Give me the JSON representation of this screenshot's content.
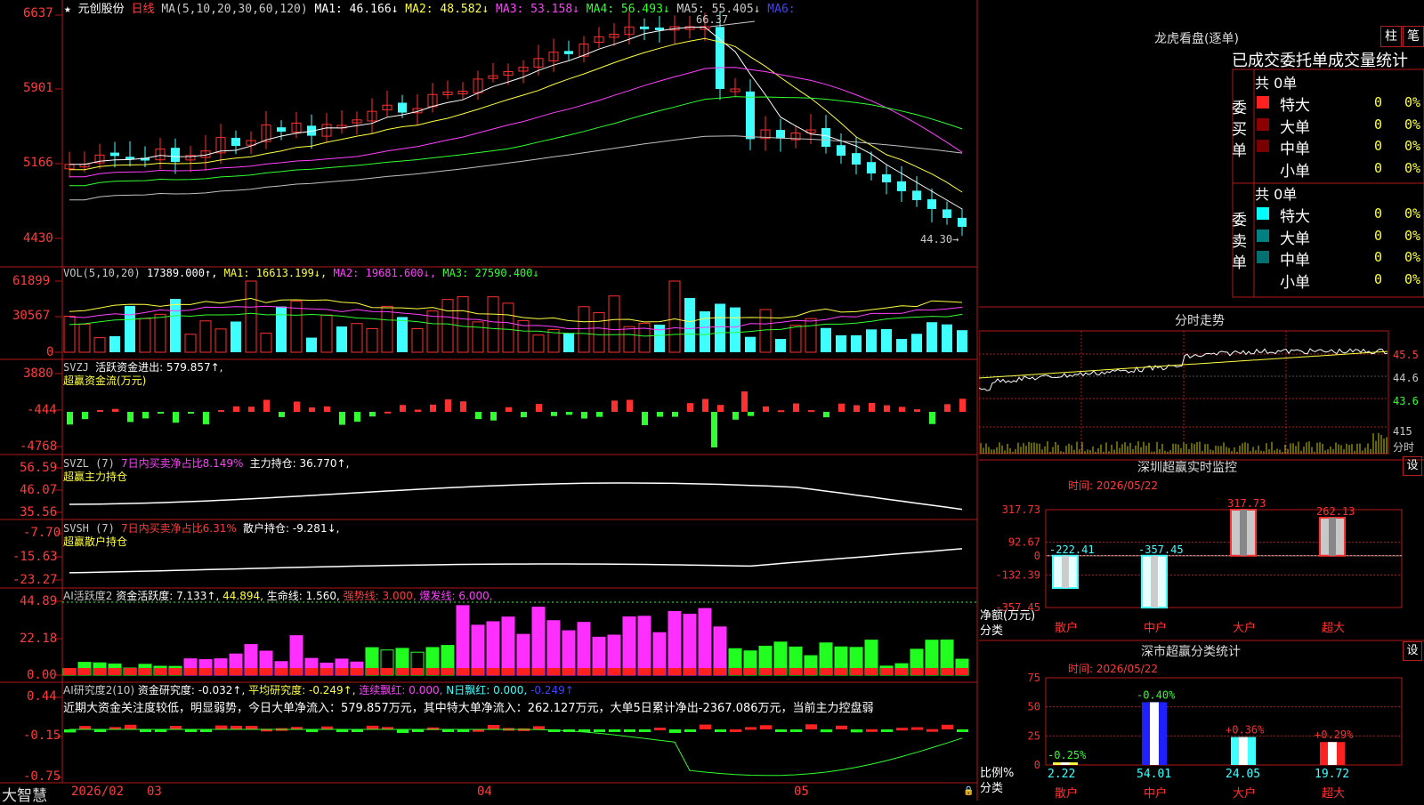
{
  "app": {
    "brand": "大智慧"
  },
  "main": {
    "header": {
      "star": "★",
      "stock_name": "元创股份",
      "period": "日线",
      "ma_params": "MA(5,10,20,30,60,120)",
      "ma1": "MA1: 46.166↓",
      "ma2": "MA2: 48.582↓",
      "ma3": "MA3: 53.158↓",
      "ma4": "MA4: 56.493↓",
      "ma5": "MA5: 55.405↓",
      "ma6": "MA6:"
    },
    "price_axis": [
      "6637",
      "5901",
      "5166",
      "4430"
    ],
    "high_label": "66.37",
    "low_label": "44.30→"
  },
  "vol": {
    "header_name": "VOL(5,10,20)",
    "header_val": "17389.000↑",
    "ma1": "MA1: 16613.199↓",
    "ma2": "MA2: 19681.600↓",
    "ma3": "MA3: 27590.400↓",
    "axis": [
      "61899",
      "30567",
      "0"
    ]
  },
  "svzj": {
    "line1_name": "SVZJ",
    "line1_val": "活跃资金进出: 579.857↑,",
    "line2": "超赢资金流(万元)",
    "axis": [
      "3880",
      "-444",
      "-4768"
    ]
  },
  "svzl": {
    "name": "SVZL (7)",
    "ratio": "7日内买卖净占比8.149%",
    "val": "主力持仓: 36.770↑,",
    "line2": "超赢主力持仓",
    "axis": [
      "56.59",
      "46.07",
      "35.56"
    ]
  },
  "svsh": {
    "name": "SVSH (7)",
    "ratio": "7日内买卖净占比6.31%",
    "val": "散户持仓: -9.281↓,",
    "line2": "超赢散户持仓",
    "axis": [
      "-7.70",
      "-15.63",
      "-23.27"
    ]
  },
  "ai": {
    "name": "AI活跃度2",
    "v1": "资金活跃度: 7.133↑",
    "v2": "44.894,",
    "v3": "生命线: 1.560,",
    "v4": "强势线: 3.000,",
    "v5": "爆发线: 6.000,",
    "axis": [
      "44.89",
      "22.18",
      "0.00"
    ]
  },
  "research": {
    "name": "AI研究度2(10)",
    "v1": "资金研究度: -0.032↑",
    "v2": "平均研究度: -0.249↑",
    "v3": "连续飘红: 0.000,",
    "v4": "N日飘红: 0.000,",
    "v5": "-0.249↑",
    "note": "近期大资金关注度较低，明显弱势，今日大单净流入：579.857万元，其中特大单净流入：262.127万元，大单5日累计净出-2367.086万元，当前主力控盘弱",
    "axis": [
      "0.44",
      "-0.15",
      "-0.75"
    ]
  },
  "date_axis": [
    "2026/02",
    "03",
    "04",
    "05"
  ],
  "lhb": {
    "title": "龙虎看盘(逐单)",
    "btn1": "柱",
    "btn2": "笔",
    "subtitle": "已成交委托单成交量统计",
    "buy": {
      "side": "委买单",
      "total": "共 0单",
      "rows": [
        {
          "label": "特大",
          "value": "0",
          "pct": "0%",
          "color": "#ff2020"
        },
        {
          "label": "大单",
          "value": "0",
          "pct": "0%",
          "color": "#8b0000"
        },
        {
          "label": "中单",
          "value": "0",
          "pct": "0%",
          "color": "#7a0000"
        },
        {
          "label": "小单",
          "value": "0",
          "pct": "0%",
          "color": ""
        }
      ]
    },
    "sell": {
      "side": "委卖单",
      "total": "共 0单",
      "rows": [
        {
          "label": "特大",
          "value": "0",
          "pct": "0%",
          "color": "#00ffff"
        },
        {
          "label": "大单",
          "value": "0",
          "pct": "0%",
          "color": "#008080"
        },
        {
          "label": "中单",
          "value": "0",
          "pct": "0%",
          "color": "#007070"
        },
        {
          "label": "小单",
          "value": "0",
          "pct": "0%",
          "color": ""
        }
      ]
    }
  },
  "intraday": {
    "title": "分时走势",
    "axis": [
      "45.5",
      "44.6",
      "43.6"
    ],
    "vol_label": "415",
    "vol_unit": "分时"
  },
  "sz_monitor": {
    "title": "深圳超赢实时监控",
    "set": "设",
    "time": "时间: 2026/05/22",
    "axis": [
      "317.73",
      "92.67",
      "0",
      "-132.39",
      "-357.45"
    ],
    "ylabel": "净额(万元)",
    "xlabel": "分类",
    "chart_data": {
      "type": "bar",
      "categories": [
        "散户",
        "中户",
        "大户",
        "超大"
      ],
      "values": [
        -222.41,
        -357.45,
        317.73,
        262.13
      ],
      "ylim": [
        -357.45,
        317.73
      ],
      "labels": [
        "-222.41",
        "-357.45",
        "317.73",
        "262.13"
      ]
    }
  },
  "sz_class": {
    "title": "深市超赢分类统计",
    "set": "设",
    "time": "时间: 2026/05/22",
    "axis": [
      "75",
      "50",
      "25",
      "0"
    ],
    "ylabel": "比例%",
    "xlabel": "分类",
    "chart_data": {
      "type": "bar",
      "categories": [
        "散户",
        "中户",
        "大户",
        "超大"
      ],
      "values": [
        2.22,
        54.01,
        24.05,
        19.72
      ],
      "ylim": [
        0,
        75
      ],
      "changes": [
        "-0.25%",
        "-0.40%",
        "+0.36%",
        "+0.29%"
      ],
      "labels": [
        "2.22",
        "54.01",
        "24.05",
        "19.72"
      ]
    }
  }
}
